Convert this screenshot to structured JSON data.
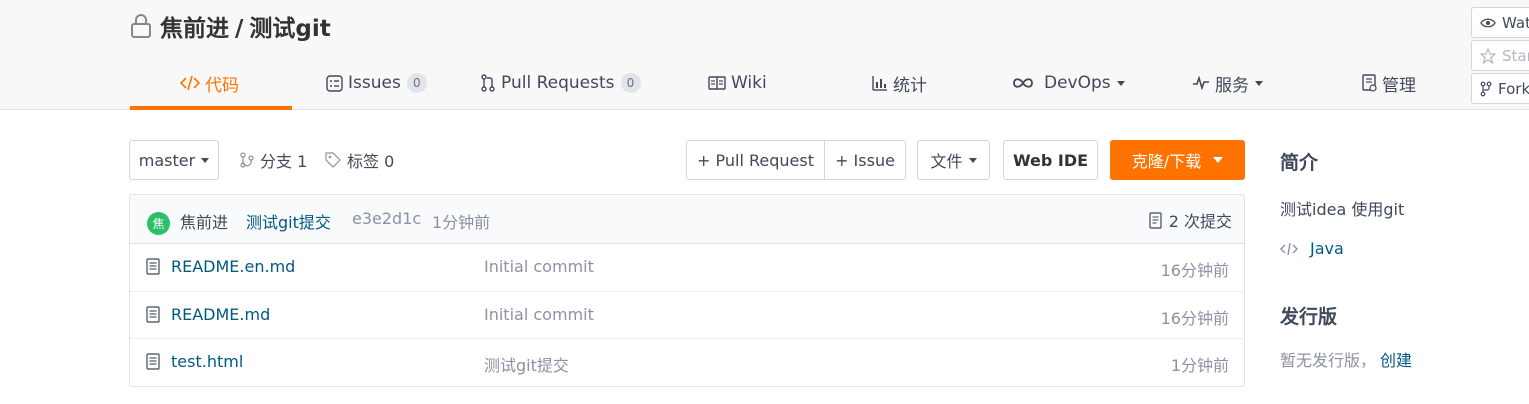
{
  "colors": {
    "accent": "#fe7300",
    "link": "#005980",
    "muted": "#8c92a4",
    "avatar_bg": "#2cbe6a"
  },
  "repo": {
    "owner": "焦前进",
    "separator": "/",
    "name": "测试git"
  },
  "tabs": [
    {
      "label": "代码",
      "icon": "code-icon",
      "active": true
    },
    {
      "label": "Issues",
      "icon": "issues-icon",
      "count": "0"
    },
    {
      "label": "Pull Requests",
      "icon": "pull-request-icon",
      "count": "0"
    },
    {
      "label": "Wiki",
      "icon": "wiki-icon"
    },
    {
      "label": "统计",
      "icon": "bar-chart-icon"
    },
    {
      "label": "DevOps",
      "icon": "infinity-icon",
      "dropdown": true
    },
    {
      "label": "服务",
      "icon": "pulse-icon",
      "dropdown": true
    },
    {
      "label": "管理",
      "icon": "settings-doc-icon"
    }
  ],
  "side_actions": {
    "watch": "Watch",
    "star": "Star",
    "fork": "Fork"
  },
  "toolbar": {
    "branch": "master",
    "branches": "分支 1",
    "tags": "标签 0",
    "new_pr": "+ Pull Request",
    "new_issue": "+ Issue",
    "files": "文件",
    "web_ide": "Web IDE",
    "clone": "克隆/下载"
  },
  "last_commit": {
    "avatar_text": "焦",
    "author": "焦前进",
    "message": "测试git提交",
    "sha": "e3e2d1c",
    "time": "1分钟前",
    "count": "2 次提交"
  },
  "files": [
    {
      "name": "README.en.md",
      "message": "Initial commit",
      "time": "16分钟前"
    },
    {
      "name": "README.md",
      "message": "Initial commit",
      "time": "16分钟前"
    },
    {
      "name": "test.html",
      "message": "测试git提交",
      "time": "1分钟前"
    }
  ],
  "aside": {
    "intro_title": "简介",
    "intro_text": "测试idea 使用git",
    "language": "Java",
    "release_title": "发行版",
    "release_text": "暂无发行版，",
    "release_link": "创建"
  }
}
